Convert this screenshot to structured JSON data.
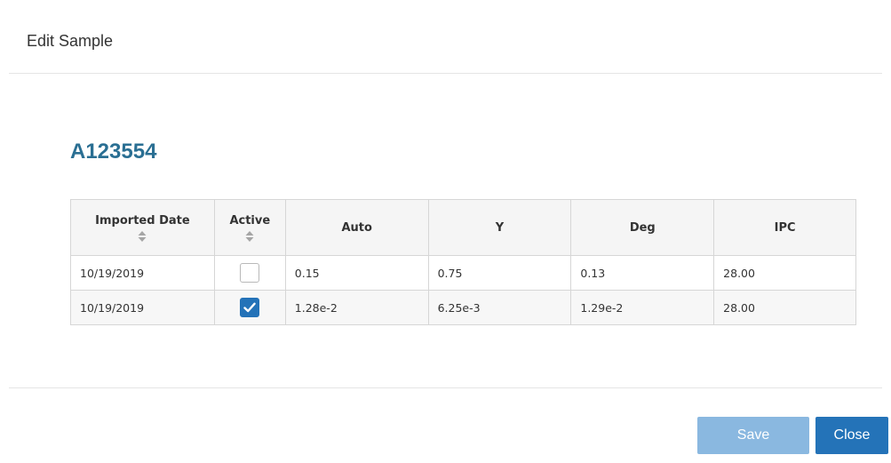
{
  "modal": {
    "title": "Edit Sample",
    "sample_id": "A123554"
  },
  "table": {
    "columns": [
      "Imported Date",
      "Active",
      "Auto",
      "Y",
      "Deg",
      "IPC"
    ],
    "sortable": [
      "Imported Date",
      "Active"
    ],
    "rows": [
      {
        "imported_date": "10/19/2019",
        "active": false,
        "auto": "0.15",
        "y": "0.75",
        "deg": "0.13",
        "ipc": "28.00"
      },
      {
        "imported_date": "10/19/2019",
        "active": true,
        "auto": "1.28e-2",
        "y": "6.25e-3",
        "deg": "1.29e-2",
        "ipc": "28.00"
      }
    ]
  },
  "footer": {
    "save_label": "Save",
    "close_label": "Close"
  },
  "colors": {
    "title_accent": "#2a6f93",
    "primary_button": "#2473b8",
    "disabled_button": "#8ab8e0"
  },
  "icons": {
    "sort": "sort-icon",
    "checkmark": "check-icon"
  }
}
